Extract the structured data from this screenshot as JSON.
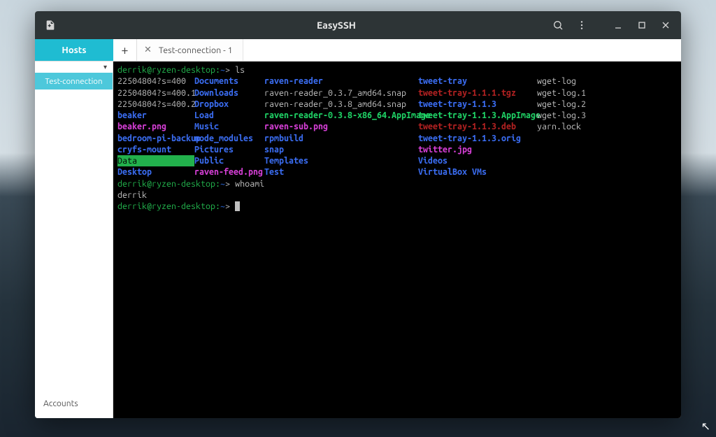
{
  "titlebar": {
    "title": "EasySSH"
  },
  "toolbar": {
    "hosts_label": "Hosts",
    "tab": {
      "label": "Test-connection - 1"
    }
  },
  "sidebar": {
    "item": "Test-connection",
    "footer": "Accounts"
  },
  "terminal": {
    "user": "derrik",
    "host": "ryzen-desktop",
    "prompt": "derrik@ryzen-desktop:",
    "tilde": "~",
    "dollar": ">",
    "cmd_ls": "ls",
    "cmd_whoami": "whoami",
    "whoami_out": "derrik",
    "ls_rows": [
      {
        "c0": {
          "t": "22504804?s=400",
          "cls": "c-white"
        },
        "c1": {
          "t": "Documents",
          "cls": "c-blue"
        },
        "c2": {
          "t": "raven-reader",
          "cls": "c-blue"
        },
        "c3": {
          "t": "tweet-tray",
          "cls": "c-blue"
        },
        "c4": {
          "t": "wget-log",
          "cls": "c-white"
        }
      },
      {
        "c0": {
          "t": "22504804?s=400.1",
          "cls": "c-white"
        },
        "c1": {
          "t": "Downloads",
          "cls": "c-blue"
        },
        "c2": {
          "t": "raven-reader_0.3.7_amd64.snap",
          "cls": "c-white"
        },
        "c3": {
          "t": "tweet-tray-1.1.1.tgz",
          "cls": "c-dred"
        },
        "c4": {
          "t": "wget-log.1",
          "cls": "c-white"
        }
      },
      {
        "c0": {
          "t": "22504804?s=400.2",
          "cls": "c-white"
        },
        "c1": {
          "t": "Dropbox",
          "cls": "c-blue"
        },
        "c2": {
          "t": "raven-reader_0.3.8_amd64.snap",
          "cls": "c-white"
        },
        "c3": {
          "t": "tweet-tray-1.1.3",
          "cls": "c-blue"
        },
        "c4": {
          "t": "wget-log.2",
          "cls": "c-white"
        }
      },
      {
        "c0": {
          "t": "beaker",
          "cls": "c-blue"
        },
        "c1": {
          "t": "Load",
          "cls": "c-blue"
        },
        "c2": {
          "t": "raven-reader-0.3.8-x86_64.AppImage",
          "cls": "c-lgreen"
        },
        "c3": {
          "t": "tweet-tray-1.1.3.AppImage",
          "cls": "c-lgreen"
        },
        "c4": {
          "t": "wget-log.3",
          "cls": "c-white"
        }
      },
      {
        "c0": {
          "t": "beaker.png",
          "cls": "c-mag"
        },
        "c1": {
          "t": "Music",
          "cls": "c-blue"
        },
        "c2": {
          "t": "raven-sub.png",
          "cls": "c-mag"
        },
        "c3": {
          "t": "tweet-tray-1.1.3.deb",
          "cls": "c-dred"
        },
        "c4": {
          "t": "yarn.lock",
          "cls": "c-white"
        }
      },
      {
        "c0": {
          "t": "bedroom-pi-backup",
          "cls": "c-blue"
        },
        "c1": {
          "t": "node_modules",
          "cls": "c-blue"
        },
        "c2": {
          "t": "rpmbuild",
          "cls": "c-blue"
        },
        "c3": {
          "t": "tweet-tray-1.1.3.orig",
          "cls": "c-blue"
        },
        "c4": {
          "t": "",
          "cls": ""
        }
      },
      {
        "c0": {
          "t": "cryfs-mount",
          "cls": "c-blue"
        },
        "c1": {
          "t": "Pictures",
          "cls": "c-blue"
        },
        "c2": {
          "t": "snap",
          "cls": "c-blue"
        },
        "c3": {
          "t": "twitter.jpg",
          "cls": "c-mag"
        },
        "c4": {
          "t": "",
          "cls": ""
        }
      },
      {
        "c0": {
          "t": "Data",
          "cls": "c-greenbg"
        },
        "c1": {
          "t": "Public",
          "cls": "c-blue"
        },
        "c2": {
          "t": "Templates",
          "cls": "c-blue"
        },
        "c3": {
          "t": "Videos",
          "cls": "c-blue"
        },
        "c4": {
          "t": "",
          "cls": ""
        }
      },
      {
        "c0": {
          "t": "Desktop",
          "cls": "c-blue"
        },
        "c1": {
          "t": "raven-feed.png",
          "cls": "c-mag"
        },
        "c2": {
          "t": "Test",
          "cls": "c-blue"
        },
        "c3": {
          "t": "VirtualBox VMs",
          "cls": "c-blue"
        },
        "c4": {
          "t": "",
          "cls": ""
        }
      }
    ]
  }
}
